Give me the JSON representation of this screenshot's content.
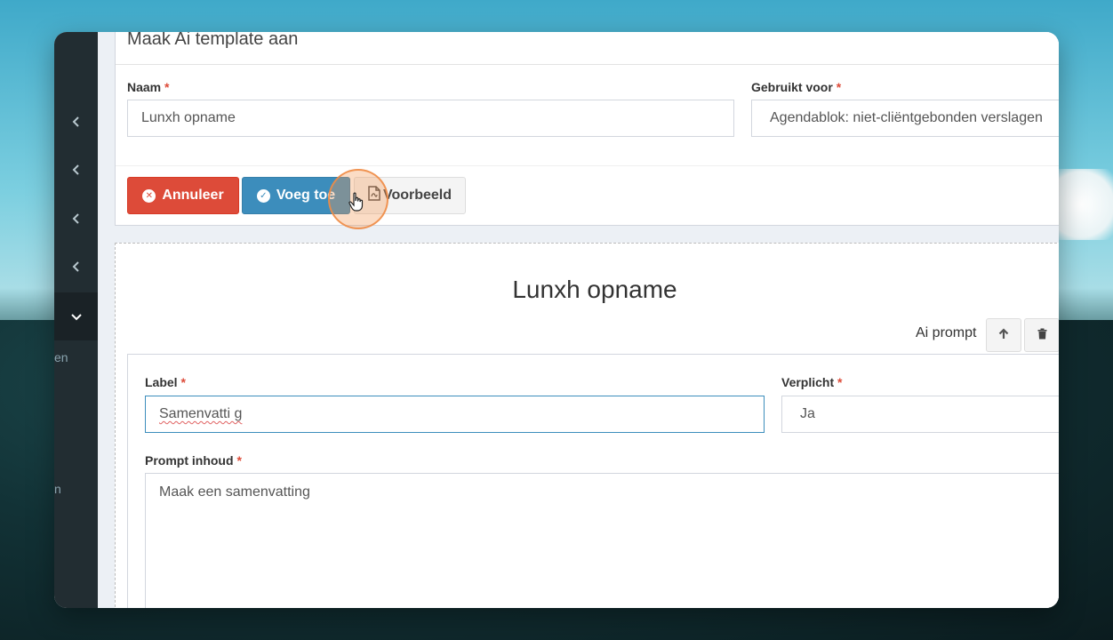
{
  "form": {
    "title": "Maak Ai template aan",
    "naam_label": "Naam",
    "naam_value": "Lunxh opname",
    "gebruikt_label": "Gebruikt voor",
    "gebruikt_value": "Agendablok: niet-cliëntgebonden verslagen",
    "required_mark": "*"
  },
  "buttons": {
    "cancel": "Annuleer",
    "add": "Voeg toe",
    "preview": "Voorbeeld"
  },
  "sidebar": {
    "items": [
      "chevron-left-icon",
      "chevron-left-icon",
      "chevron-left-icon",
      "chevron-left-icon",
      "chevron-down-icon"
    ],
    "partial_texts": [
      "en",
      "n"
    ]
  },
  "section": {
    "title": "Lunxh opname",
    "type_label": "Ai prompt",
    "label_label": "Label",
    "label_value": "Samenvatti g",
    "verplicht_label": "Verplicht",
    "verplicht_value": "Ja",
    "prompt_label": "Prompt inhoud",
    "prompt_value": "Maak een samenvatting"
  },
  "colors": {
    "danger": "#dd4b39",
    "primary": "#3c8dbc",
    "sidebar": "#222d32",
    "highlight": "#f39c58"
  }
}
